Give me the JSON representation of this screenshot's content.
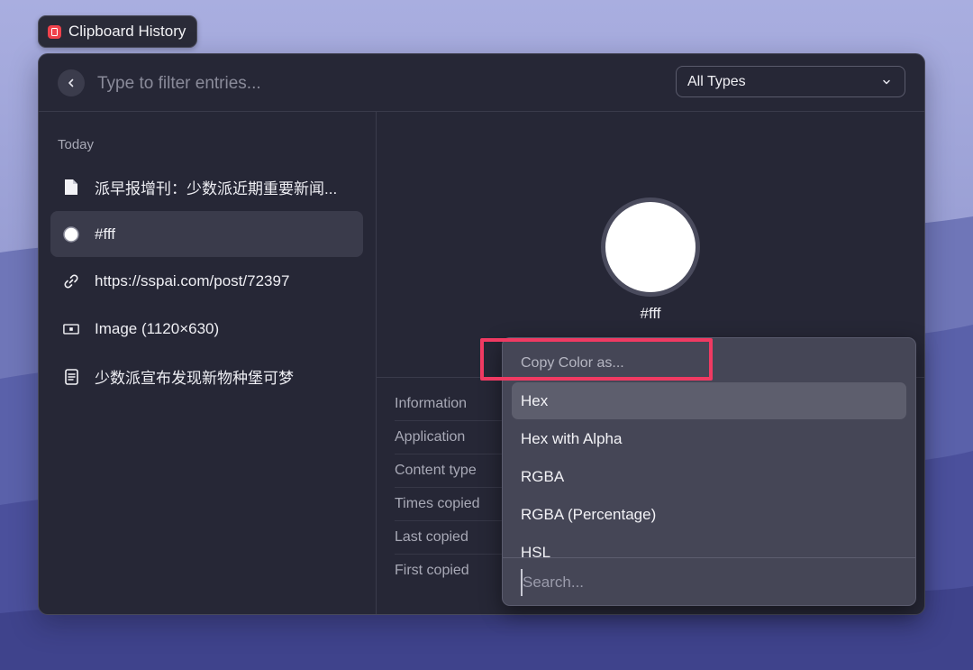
{
  "app": {
    "title": "Clipboard History",
    "accent": "#f0424c"
  },
  "search": {
    "placeholder": "Type to filter entries...",
    "value": ""
  },
  "type_filter": {
    "selected": "All Types"
  },
  "history": {
    "section_label": "Today",
    "entries": [
      {
        "label": "派早报增刊：少数派近期重要新闻...",
        "icon": "document-icon"
      },
      {
        "label": "#fff",
        "icon": "color-dot-icon",
        "selected": true
      },
      {
        "label": "https://sspai.com/post/72397",
        "icon": "link-icon"
      },
      {
        "label": "Image (1120×630)",
        "icon": "image-icon"
      },
      {
        "label": "少数派宣布发现新物种堡可梦",
        "icon": "text-icon"
      }
    ]
  },
  "preview": {
    "color_value": "#fff",
    "swatch_color": "#ffffff"
  },
  "metadata": {
    "rows": [
      {
        "label": "Information"
      },
      {
        "label": "Application"
      },
      {
        "label": "Content type"
      },
      {
        "label": "Times copied"
      },
      {
        "label": "Last copied"
      },
      {
        "label": "First copied"
      }
    ]
  },
  "copy_menu": {
    "header": "Copy Color as...",
    "options": [
      {
        "label": "Hex",
        "active": true
      },
      {
        "label": "Hex with Alpha"
      },
      {
        "label": "RGBA"
      },
      {
        "label": "RGBA (Percentage)"
      },
      {
        "label": "HSL"
      }
    ],
    "search_placeholder": "Search...",
    "highlight_color": "#f03a62"
  }
}
